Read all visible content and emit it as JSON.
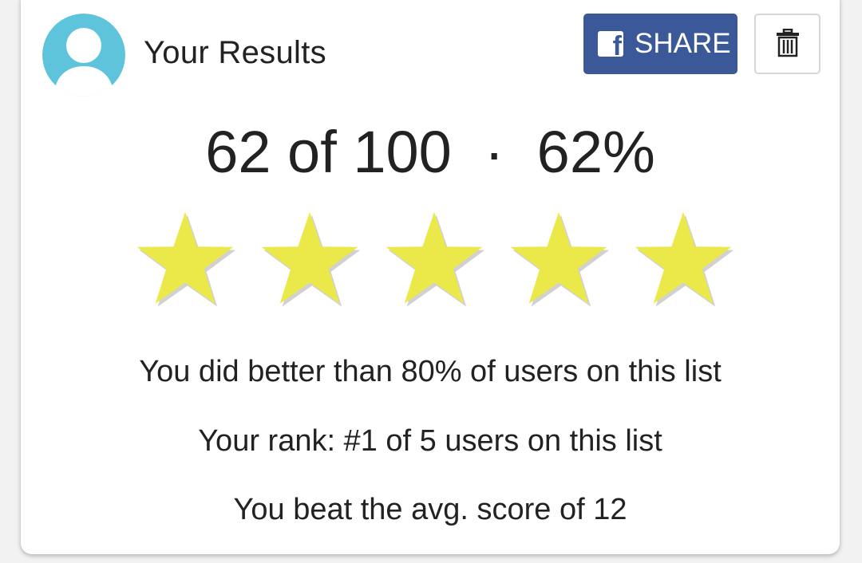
{
  "header": {
    "title": "Your Results"
  },
  "actions": {
    "share_label": "SHARE",
    "share_color": "#3b5998",
    "delete_icon": "trash-icon"
  },
  "score": {
    "correct": "62",
    "of_label": "of",
    "total": "100",
    "separator": "·",
    "percent": "62%",
    "display": "62 of 100  ·  62%"
  },
  "rating": {
    "stars_filled": 5,
    "stars_total": 5,
    "star_color": "#ebe94a"
  },
  "stats": {
    "better_than": "You did better than 80% of users on this list",
    "rank": "Your rank: #1 of 5 users on this list",
    "avg": "You beat the avg. score of 12"
  },
  "colors": {
    "avatar": "#5ec4dc",
    "text": "#222222"
  }
}
